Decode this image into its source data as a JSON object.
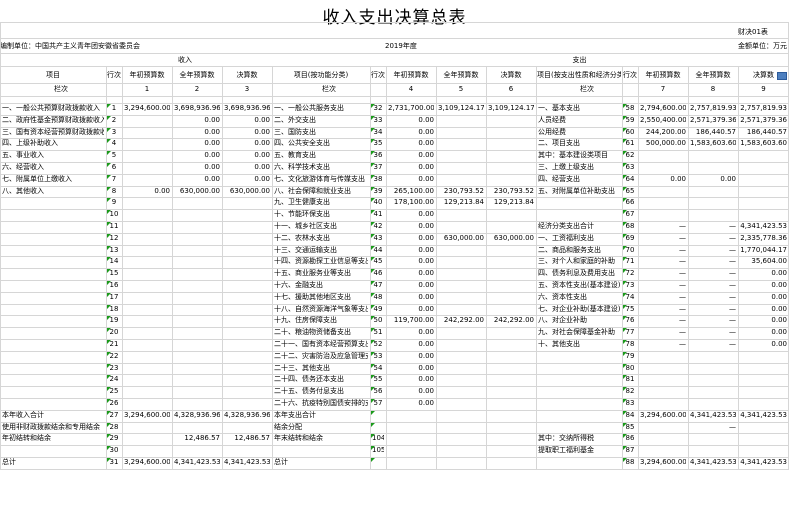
{
  "title": "收入支出决算总表",
  "table_code": "财决01表",
  "unit_label": "编制单位：中国共产主义青年团安徽省委员会",
  "year": "2019年度",
  "currency_label": "金额单位：万元",
  "income_section": "收入",
  "expense_section": "支出",
  "header_row": [
    "项目",
    "行次",
    "年初预算数",
    "全年预算数",
    "决算数",
    "项目(按功能分类)",
    "行次",
    "年初预算数",
    "全年预算数",
    "决算数",
    "项目(按支出性质和经济分类)",
    "行次",
    "年初预算数",
    "全年预算数",
    "决算数"
  ],
  "col_no_row": [
    "栏次",
    "1",
    "2",
    "3",
    "栏次",
    "4",
    "5",
    "6",
    "栏次",
    "7",
    "8",
    "9"
  ],
  "rows": [
    [
      "一、一般公共预算财政拨款收入",
      "1",
      "3,294,600.00",
      "3,698,936.96",
      "3,698,936.96",
      "一、一般公共服务支出",
      "32",
      "2,731,700.00",
      "3,109,124.17",
      "3,109,124.17",
      "一、基本支出",
      "58",
      "2,794,600.00",
      "2,757,819.93",
      "2,757,819.93"
    ],
    [
      "二、政府性基金预算财政拨款收入",
      "2",
      "",
      "0.00",
      "0.00",
      "二、外交支出",
      "33",
      "0.00",
      "",
      "",
      "人员经费",
      "59",
      "2,550,400.00",
      "2,571,379.36",
      "2,571,379.36"
    ],
    [
      "三、国有资本经营预算财政拨款收入",
      "3",
      "",
      "0.00",
      "0.00",
      "三、国防支出",
      "34",
      "0.00",
      "",
      "",
      "公用经费",
      "60",
      "244,200.00",
      "186,440.57",
      "186,440.57"
    ],
    [
      "四、上级补助收入",
      "4",
      "",
      "0.00",
      "0.00",
      "四、公共安全支出",
      "35",
      "0.00",
      "",
      "",
      "二、项目支出",
      "61",
      "500,000.00",
      "1,583,603.60",
      "1,583,603.60"
    ],
    [
      "五、事业收入",
      "5",
      "",
      "0.00",
      "0.00",
      "五、教育支出",
      "36",
      "0.00",
      "",
      "",
      "其中：基本建设类项目",
      "62",
      "",
      "",
      ""
    ],
    [
      "六、经营收入",
      "6",
      "",
      "0.00",
      "0.00",
      "六、科学技术支出",
      "37",
      "0.00",
      "",
      "",
      "三、上缴上级支出",
      "63",
      "",
      "",
      ""
    ],
    [
      "七、附属单位上缴收入",
      "7",
      "",
      "0.00",
      "0.00",
      "七、文化旅游体育与传媒支出",
      "38",
      "0.00",
      "",
      "",
      "四、经营支出",
      "64",
      "0.00",
      "0.00",
      ""
    ],
    [
      "八、其他收入",
      "8",
      "0.00",
      "630,000.00",
      "630,000.00",
      "八、社会保障和就业支出",
      "39",
      "265,100.00",
      "230,793.52",
      "230,793.52",
      "五、对附属单位补助支出",
      "65",
      "",
      "",
      ""
    ],
    [
      "",
      "9",
      "",
      "",
      "",
      "九、卫生健康支出",
      "40",
      "178,100.00",
      "129,213.84",
      "129,213.84",
      "",
      "66",
      "",
      "",
      ""
    ],
    [
      "",
      "10",
      "",
      "",
      "",
      "十、节能环保支出",
      "41",
      "0.00",
      "",
      "",
      "",
      "67",
      "",
      "",
      ""
    ],
    [
      "",
      "11",
      "",
      "",
      "",
      "十一、城乡社区支出",
      "42",
      "0.00",
      "",
      "",
      "经济分类支出合计",
      "68",
      "—",
      "—",
      "4,341,423.53"
    ],
    [
      "",
      "12",
      "",
      "",
      "",
      "十二、农林水支出",
      "43",
      "0.00",
      "630,000.00",
      "630,000.00",
      "一、工资福利支出",
      "69",
      "—",
      "—",
      "2,335,778.36"
    ],
    [
      "",
      "13",
      "",
      "",
      "",
      "十三、交通运输支出",
      "44",
      "0.00",
      "",
      "",
      "二、商品和服务支出",
      "70",
      "—",
      "—",
      "1,770,044.17"
    ],
    [
      "",
      "14",
      "",
      "",
      "",
      "十四、资源勘探工业信息等支出",
      "45",
      "0.00",
      "",
      "",
      "三、对个人和家庭的补助",
      "71",
      "—",
      "—",
      "35,604.00"
    ],
    [
      "",
      "15",
      "",
      "",
      "",
      "十五、商业服务业等支出",
      "46",
      "0.00",
      "",
      "",
      "四、债务利息及费用支出",
      "72",
      "—",
      "—",
      "0.00"
    ],
    [
      "",
      "16",
      "",
      "",
      "",
      "十六、金融支出",
      "47",
      "0.00",
      "",
      "",
      "五、资本性支出(基本建设)",
      "73",
      "—",
      "—",
      "0.00"
    ],
    [
      "",
      "17",
      "",
      "",
      "",
      "十七、援助其他地区支出",
      "48",
      "0.00",
      "",
      "",
      "六、资本性支出",
      "74",
      "—",
      "—",
      "0.00"
    ],
    [
      "",
      "18",
      "",
      "",
      "",
      "十八、自然资源海洋气象等支出",
      "49",
      "0.00",
      "",
      "",
      "七、对企业补助(基本建设)",
      "75",
      "—",
      "—",
      "0.00"
    ],
    [
      "",
      "19",
      "",
      "",
      "",
      "十九、住房保障支出",
      "50",
      "119,700.00",
      "242,292.00",
      "242,292.00",
      "八、对企业补助",
      "76",
      "—",
      "—",
      "0.00"
    ],
    [
      "",
      "20",
      "",
      "",
      "",
      "二十、粮油物资储备支出",
      "51",
      "0.00",
      "",
      "",
      "九、对社会保障基金补助",
      "77",
      "—",
      "—",
      "0.00"
    ],
    [
      "",
      "21",
      "",
      "",
      "",
      "二十一、国有资本经营预算支出",
      "52",
      "0.00",
      "",
      "",
      "十、其他支出",
      "78",
      "—",
      "—",
      "0.00"
    ],
    [
      "",
      "22",
      "",
      "",
      "",
      "二十二、灾害防治及应急管理支出",
      "53",
      "0.00",
      "",
      "",
      "",
      "79",
      "",
      "",
      ""
    ],
    [
      "",
      "23",
      "",
      "",
      "",
      "二十三、其他支出",
      "54",
      "0.00",
      "",
      "",
      "",
      "80",
      "",
      "",
      ""
    ],
    [
      "",
      "24",
      "",
      "",
      "",
      "二十四、债务还本支出",
      "55",
      "0.00",
      "",
      "",
      "",
      "81",
      "",
      "",
      ""
    ],
    [
      "",
      "25",
      "",
      "",
      "",
      "二十五、债务付息支出",
      "56",
      "0.00",
      "",
      "",
      "",
      "82",
      "",
      "",
      ""
    ],
    [
      "",
      "26",
      "",
      "",
      "",
      "二十六、抗疫特别国债安排的支出",
      "57",
      "0.00",
      "",
      "",
      "",
      "83",
      "",
      "",
      ""
    ],
    [
      "本年收入合计",
      "27",
      "3,294,600.00",
      "4,328,936.96",
      "4,328,936.96",
      "本年支出合计",
      "",
      "",
      "",
      "",
      "",
      "84",
      "3,294,600.00",
      "4,341,423.53",
      "4,341,423.53"
    ],
    [
      "使用非财政拨款结余和专用结余",
      "28",
      "",
      "",
      "",
      "结余分配",
      "",
      "",
      "",
      "",
      "",
      "85",
      "",
      "—",
      ""
    ],
    [
      "年初结转和结余",
      "29",
      "",
      "12,486.57",
      "12,486.57",
      "年末结转和结余",
      "104",
      "",
      "",
      "",
      "其中：交纳所得税",
      "86",
      "",
      "",
      ""
    ],
    [
      "",
      "30",
      "",
      "",
      "",
      "",
      "105",
      "",
      "",
      "",
      "提取职工福利基金",
      "87",
      "",
      "",
      ""
    ],
    [
      "总计",
      "31",
      "3,294,600.00",
      "4,341,423.53",
      "4,341,423.53",
      "总计",
      "",
      "",
      "",
      "",
      "",
      "88",
      "3,294,600.00",
      "4,341,423.53",
      "4,341,423.53"
    ]
  ],
  "colors": {
    "grid": "#d6d6d6",
    "marker": "#1a9a1a",
    "button": "#4d7fbf"
  }
}
